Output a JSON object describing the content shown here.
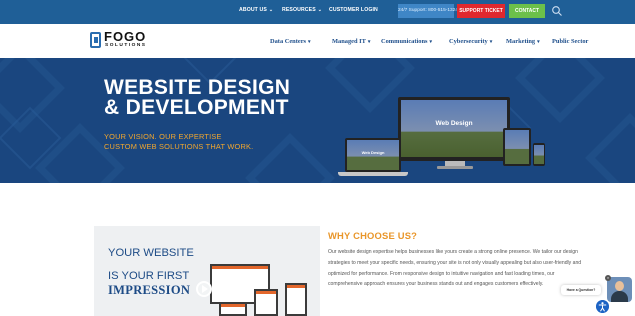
{
  "topbar": {
    "nav": [
      {
        "label": "ABOUT US",
        "dropdown": true
      },
      {
        "label": "RESOURCES",
        "dropdown": true
      },
      {
        "label": "CUSTOMER LOGIN",
        "dropdown": false
      }
    ],
    "support": "24/7 Support: 800-515-1324",
    "ticket": "SUPPORT TICKET",
    "contact": "CONTACT"
  },
  "header": {
    "logo_word": "FOGO",
    "logo_sub": "SOLUTIONS",
    "nav": [
      {
        "label": "Data Centers",
        "dropdown": true
      },
      {
        "label": "Managed IT",
        "dropdown": true
      },
      {
        "label": "Communications",
        "dropdown": true
      },
      {
        "label": "Cybersecurity",
        "dropdown": true
      },
      {
        "label": "Marketing",
        "dropdown": true
      },
      {
        "label": "Public Sector",
        "dropdown": false
      }
    ]
  },
  "hero": {
    "title_line1": "WEBSITE DESIGN",
    "title_line2": "& DEVELOPMENT",
    "sub_line1": "YOUR VISION. OUR EXPERTISE",
    "sub_line2": "CUSTOM WEB SOLUTIONS THAT WORK.",
    "desktop_label": "Web Design",
    "laptop_label": "Web Design"
  },
  "card": {
    "line1": "YOUR WEBSITE",
    "line2": "IS YOUR FIRST",
    "line3": "IMPRESSION"
  },
  "why": {
    "title": "WHY CHOOSE US?",
    "body": "Our website design expertise helps businesses like yours create a strong online presence. We tailor our design strategies to meet your specific needs, ensuring your site is not only visually appealing but also user-friendly and optimized for performance. From responsive design to intuitive navigation and fast loading times, our comprehensive approach ensures your business stands out and engages customers effectively."
  },
  "chat": {
    "prompt": "Have a Question?"
  },
  "colors": {
    "topbar": "#1f5f97",
    "hero": "#1a467f",
    "accent_orange": "#e9962a",
    "ticket_red": "#e0282e",
    "contact_green": "#6cc04a",
    "nav_blue": "#1f4f8b"
  }
}
